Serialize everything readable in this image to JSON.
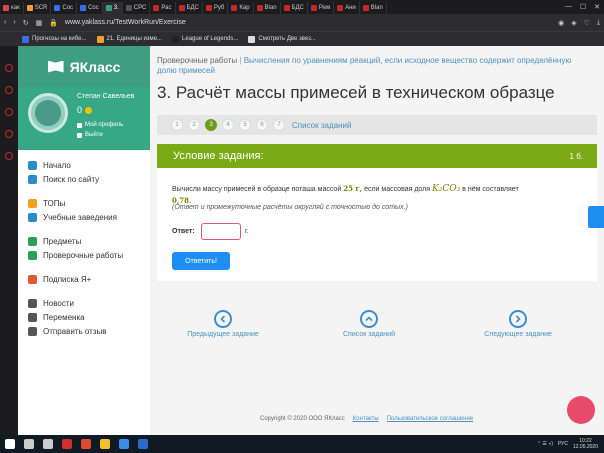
{
  "browser": {
    "tabs": [
      {
        "label": "как",
        "color": "#e04545"
      },
      {
        "label": "SCR",
        "color": "#f0a030"
      },
      {
        "label": "Сос",
        "color": "#3a6ee8"
      },
      {
        "label": "Сос",
        "color": "#3a6ee8"
      },
      {
        "label": "3.",
        "color": "#3f9e7f"
      },
      {
        "label": "СРС",
        "color": "#555555"
      },
      {
        "label": "Рас",
        "color": "#c62828"
      },
      {
        "label": "БДС",
        "color": "#c62828"
      },
      {
        "label": "Руб",
        "color": "#c62828"
      },
      {
        "label": "Кар",
        "color": "#c62828"
      },
      {
        "label": "Blan",
        "color": "#c62828"
      },
      {
        "label": "БДС",
        "color": "#c62828"
      },
      {
        "label": "Рем",
        "color": "#c62828"
      },
      {
        "label": "Ани",
        "color": "#c62828"
      },
      {
        "label": "Blan",
        "color": "#c62828"
      }
    ],
    "url": "www.yaklass.ru/TestWorkRun/Exercise",
    "bookmarks": [
      {
        "label": "Прогнозы на кибе...",
        "color": "#3a6ee8"
      },
      {
        "label": "21. Единицы изме...",
        "color": "#f0a030"
      },
      {
        "label": "League of Legends...",
        "color": "#222222"
      },
      {
        "label": "Смотреть Две звез...",
        "color": "#dddddd"
      }
    ]
  },
  "sidebar": {
    "brand": "ЯКласс",
    "user_name": "Степан Савельев",
    "score": "0",
    "my_profile": "Мой профиль",
    "logout": "Выйти",
    "nav": [
      {
        "label": "Начало",
        "icon": "home-icon",
        "color": "#2a8cc8"
      },
      {
        "label": "Поиск по сайту",
        "icon": "search-icon",
        "color": "#2a8cc8"
      },
      {
        "label": "ТОПы",
        "icon": "trophy-icon",
        "color": "#f0a020"
      },
      {
        "label": "Учебные заведения",
        "icon": "school-icon",
        "color": "#2a8cc8"
      },
      {
        "label": "Предметы",
        "icon": "subjects-icon",
        "color": "#2aa05a"
      },
      {
        "label": "Проверочные работы",
        "icon": "check-icon",
        "color": "#2aa05a"
      },
      {
        "label": "Подписка Я+",
        "icon": "subscription-icon",
        "color": "#e05a30"
      },
      {
        "label": "Новости",
        "icon": "news-icon",
        "color": "#555555"
      },
      {
        "label": "Переменка",
        "icon": "bell-icon",
        "color": "#555555"
      },
      {
        "label": "Отправить отзыв",
        "icon": "feedback-icon",
        "color": "#555555"
      }
    ]
  },
  "main": {
    "crumb_root": "Проверочные работы",
    "crumb_sep": "|",
    "crumb_topic": "Вычисления по уравнениям реакций, если исходное вещество содержит определённую долю примесей",
    "title": "3. Расчёт массы примесей в техническом образце",
    "steps": [
      "1",
      "2",
      "3",
      "4",
      "5",
      "6",
      "7"
    ],
    "active_step": 3,
    "steps_link": "Список заданий",
    "condition_title": "Условие задания:",
    "points": "1 б.",
    "question_part1": "Вычисли массу примесей в образце поташа массой",
    "mass_value": "25 г,",
    "question_part2": "если массовая доля",
    "formula": "K₂CO₃",
    "question_part3": "в нём составляет",
    "fraction_value": "0,78.",
    "hint": "(Ответ и промежуточные расчёты округляй с точностью до сотых.)",
    "answer_label": "Ответ:",
    "answer_value": "",
    "answer_unit": "г.",
    "submit_label": "Ответить!",
    "prev_label": "Предыдущее задание",
    "list_label": "Список заданий",
    "next_label": "Следующее задание",
    "copyright": "Copyright © 2020 ООО ЯКласс",
    "contacts": "Контакты",
    "agreement": "Пользовательское соглашение"
  },
  "taskbar": {
    "lang": "РУС",
    "time": "10:22",
    "date": "12.05.2020"
  }
}
